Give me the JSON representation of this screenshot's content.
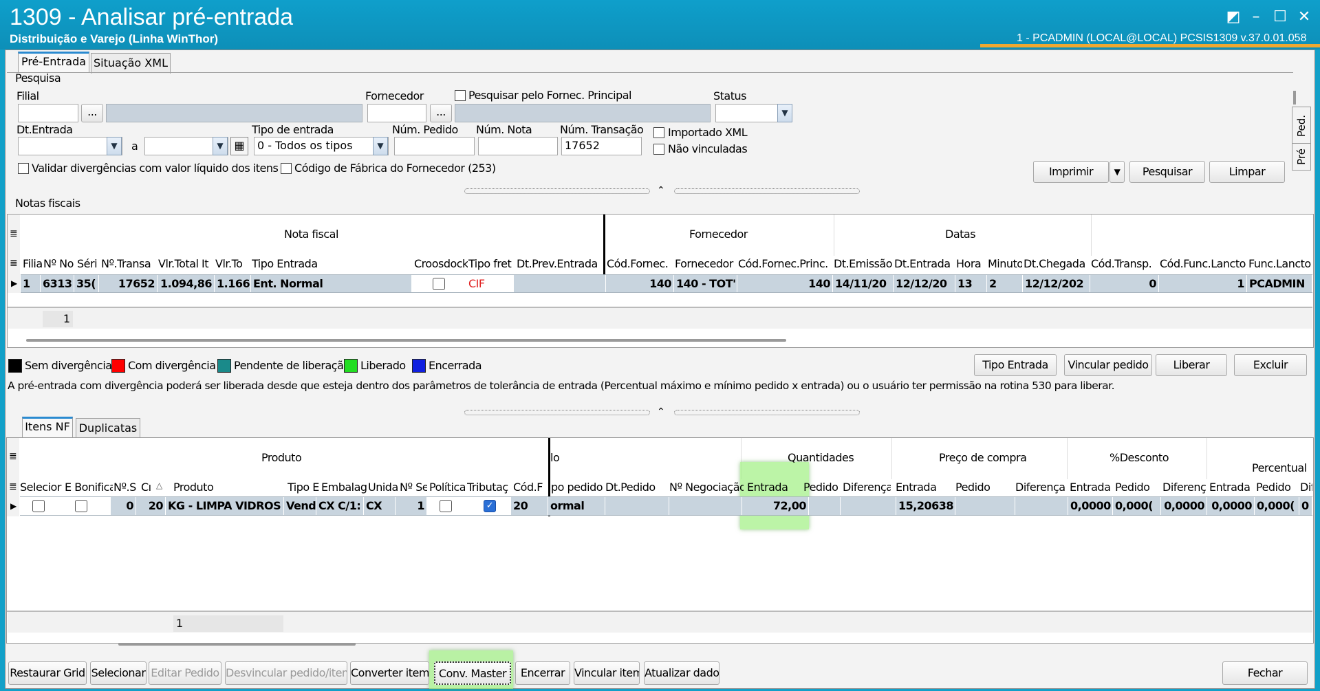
{
  "window": {
    "title": "1309 - Analisar pré-entrada",
    "subtitle": "Distribuição e Varejo (Linha WinThor)",
    "user_info": "1 - PCADMIN (LOCAL@LOCAL)   PCSIS1309  v.37.0.01.058"
  },
  "tabs_top": [
    "Pré-Entrada",
    "Situação XML"
  ],
  "search": {
    "group_label": "Pesquisa",
    "filial_label": "Filial",
    "fornecedor_label": "Fornecedor",
    "status_label": "Status",
    "pesq_fornec_label": "Pesquisar pelo Fornec. Principal",
    "dt_entrada_label": "Dt.Entrada",
    "a_label": "a",
    "tipo_entrada_label": "Tipo de entrada",
    "tipo_entrada_value": "0 - Todos os tipos",
    "num_pedido_label": "Núm. Pedido",
    "num_nota_label": "Núm. Nota",
    "num_transacao_label": "Núm. Transação",
    "num_transacao_value": "17652",
    "importado_xml_label": "Importado XML",
    "nao_vinculadas_label": "Não vinculadas",
    "validar_label": "Validar divergências com valor líquido dos itens",
    "codigo_fabrica_label": "Código de Fábrica do Fornecedor (253)",
    "buttons": {
      "imprimir": "Imprimir",
      "pesquisar": "Pesquisar",
      "limpar": "Limpar"
    },
    "ellipsis": "..."
  },
  "side_tabs": [
    "Ped.",
    "Pré"
  ],
  "notas": {
    "label": "Notas fiscais",
    "groups": [
      "Nota fiscal",
      "Fornecedor",
      "Datas"
    ],
    "columns": [
      "Filia",
      "Nº No",
      "Séri",
      "Nº.Transa",
      "Vlr.Total It",
      "Vlr.To",
      "Tipo Entrada",
      "Croosdock",
      "Tipo fret",
      "Dt.Prev.Entrada",
      "Cód.Fornec.",
      "Fornecedor",
      "Cód.Fornec.Princ.",
      "Dt.Emissão",
      "Dt.Entrada",
      "Hora",
      "Minuto",
      "Dt.Chegada",
      "Cód.Transp.",
      "Cód.Func.Lancto",
      "Func.Lancto"
    ],
    "row": [
      "1",
      "6313",
      "35(",
      "17652",
      "1.094,86",
      "1.166",
      "Ent. Normal",
      "",
      "CIF",
      "",
      "140",
      "140 - TOT'",
      "140",
      "14/11/20",
      "12/12/20",
      "13",
      "2",
      "12/12/202",
      "0",
      "1",
      "PCADMIN"
    ],
    "footer_count": "1"
  },
  "legend": [
    {
      "label": "Sem divergência",
      "color": "#000000"
    },
    {
      "label": "Com divergência",
      "color": "#ff0000"
    },
    {
      "label": "Pendente de liberação",
      "color": "#1a8a8a"
    },
    {
      "label": "Liberado",
      "color": "#22dd22"
    },
    {
      "label": "Encerrada",
      "color": "#1020e0"
    }
  ],
  "actions": {
    "tipo_entrada": "Tipo Entrada",
    "vincular_pedido": "Vincular pedido",
    "liberar": "Liberar",
    "excluir": "Excluir"
  },
  "info_text": "A pré-entrada com divergência poderá ser liberada desde que esteja dentro dos parâmetros de tolerância de entrada (Percentual máximo e mínimo pedido x entrada) ou o usuário ter permissão na rotina 530 para liberar.",
  "tabs_bottom": [
    "Itens NF",
    "Duplicatas"
  ],
  "itens": {
    "groups": [
      "Produto",
      "lo",
      "Quantidades",
      "Preço de compra",
      "%Desconto",
      "Percentual"
    ],
    "columns": [
      "Selecior",
      "E Bonifica",
      "Nº.S",
      "Cı",
      "Produto",
      "Tipo E",
      "Embalag",
      "Unida",
      "Nº Se",
      "Política",
      "Tributaç",
      "Cód.F",
      "ipo pedido",
      "Dt.Pedido",
      "Nº Negociação",
      "Entrada",
      "Pedido",
      "Diferença",
      "Entrada",
      "Pedido",
      "Diferença",
      "Entrada",
      "Pedido",
      "Diferença",
      "Entrada",
      "Pedido",
      "Dif"
    ],
    "row": [
      "",
      "",
      "0",
      "20",
      "KG - LIMPA VIDROS",
      "Vend",
      "CX C/1:",
      "CX",
      "1",
      "",
      "",
      "20",
      "ormal",
      "",
      "",
      "72,00",
      "",
      "",
      "15,20638",
      "",
      "",
      "0,0000",
      "0,000(",
      "0,0000",
      "0,0000",
      "0,000(",
      "0"
    ],
    "footer_count": "1"
  },
  "bottom_buttons": [
    "Restaurar Grid",
    "Selecionar",
    "Editar Pedido",
    "Desvincular pedido/item",
    "Converter item",
    "Conv. Master",
    "Encerrar",
    "Vincular item",
    "Atualizar dados",
    "Fechar"
  ],
  "colors": {
    "titlebar": "#0f9fcb",
    "accent_orange": "#f0a830",
    "selected_row": "#c8d4de",
    "highlight": "#a0f082"
  }
}
